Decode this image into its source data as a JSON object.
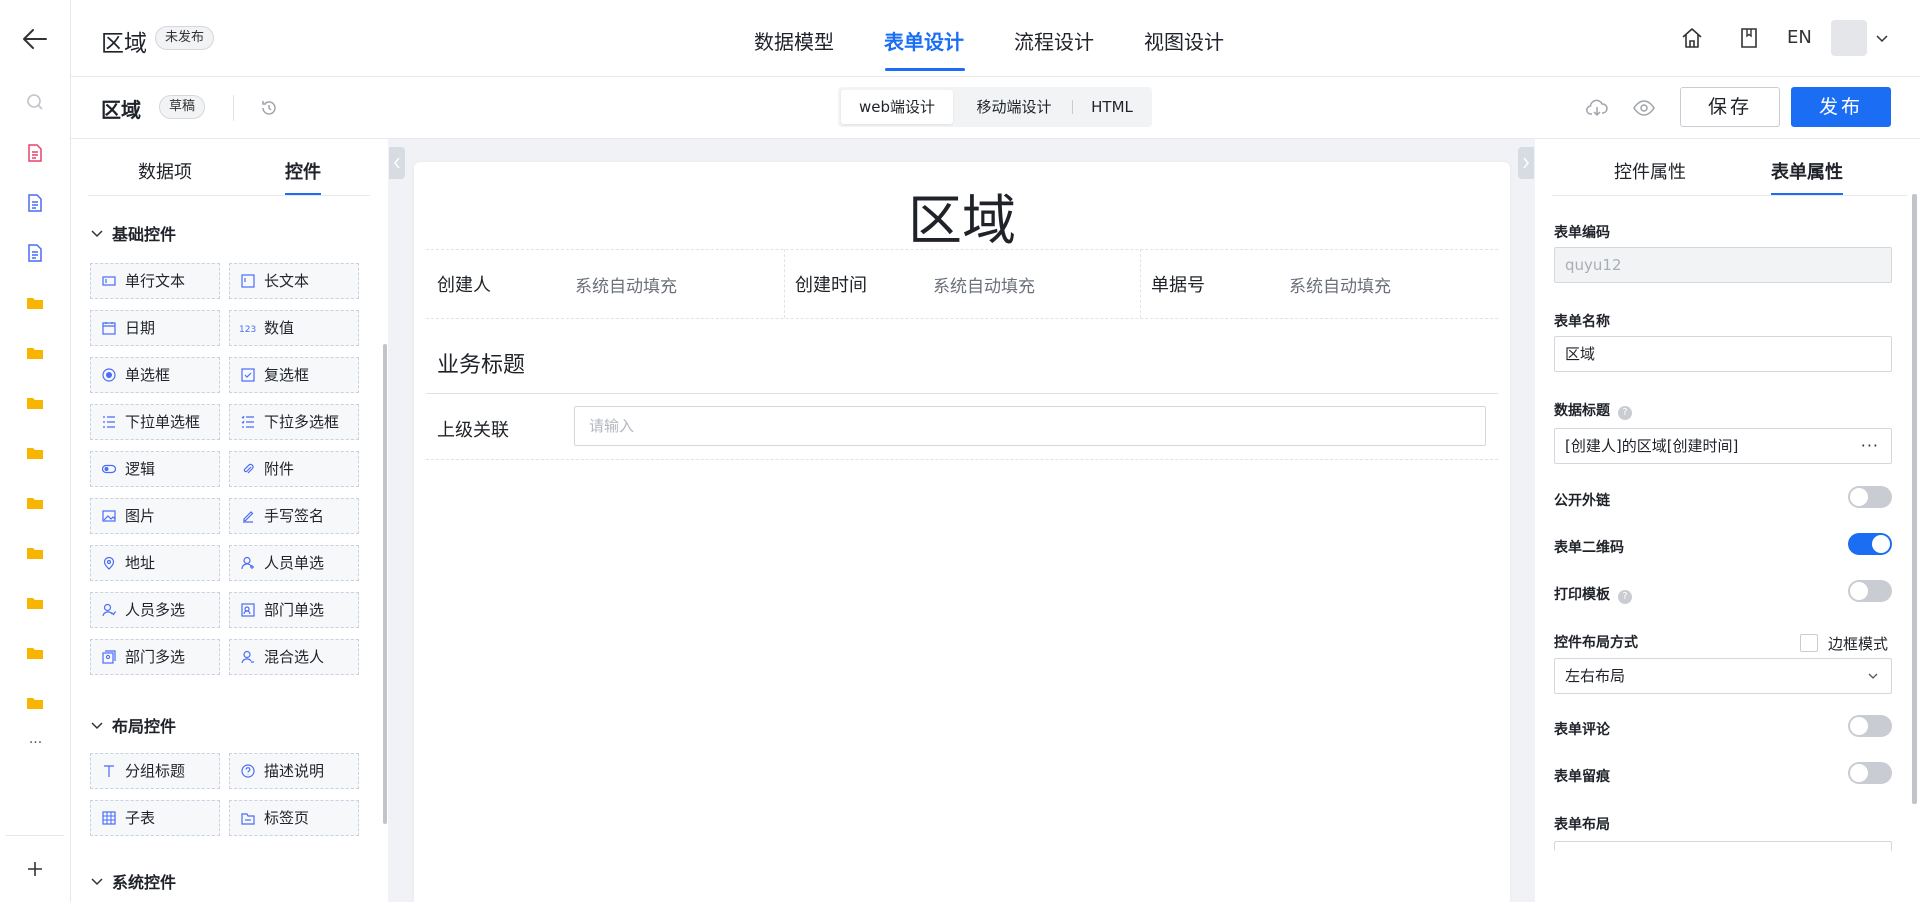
{
  "app": {
    "title": "区域",
    "status_badge": "未发布"
  },
  "nav": {
    "tabs": [
      {
        "label": "数据模型"
      },
      {
        "label": "表单设计"
      },
      {
        "label": "流程设计"
      },
      {
        "label": "视图设计"
      }
    ],
    "active": "表单设计"
  },
  "header": {
    "lang": "EN"
  },
  "form_header": {
    "title": "区域",
    "draft_badge": "草稿"
  },
  "design_modes": {
    "options": [
      "web端设计",
      "移动端设计",
      "HTML"
    ],
    "active": "web端设计"
  },
  "actions": {
    "save": "保存",
    "publish": "发布"
  },
  "left_panel": {
    "tabs": [
      "数据项",
      "控件"
    ],
    "active_tab": "控件",
    "sections": [
      {
        "title": "基础控件",
        "items": [
          {
            "label": "单行文本",
            "icon": "single-line-text-icon"
          },
          {
            "label": "长文本",
            "icon": "long-text-icon"
          },
          {
            "label": "日期",
            "icon": "calendar-icon"
          },
          {
            "label": "数值",
            "icon": "number-icon"
          },
          {
            "label": "单选框",
            "icon": "radio-icon"
          },
          {
            "label": "复选框",
            "icon": "checkbox-icon"
          },
          {
            "label": "下拉单选框",
            "icon": "dropdown-single-icon"
          },
          {
            "label": "下拉多选框",
            "icon": "dropdown-multi-icon"
          },
          {
            "label": "逻辑",
            "icon": "toggle-icon"
          },
          {
            "label": "附件",
            "icon": "paperclip-icon"
          },
          {
            "label": "图片",
            "icon": "image-icon"
          },
          {
            "label": "手写签名",
            "icon": "pen-icon"
          },
          {
            "label": "地址",
            "icon": "location-pin-icon"
          },
          {
            "label": "人员单选",
            "icon": "user-icon"
          },
          {
            "label": "人员多选",
            "icon": "users-icon"
          },
          {
            "label": "部门单选",
            "icon": "department-icon"
          },
          {
            "label": "部门多选",
            "icon": "departments-icon"
          },
          {
            "label": "混合选人",
            "icon": "mixed-user-icon"
          }
        ]
      },
      {
        "title": "布局控件",
        "items": [
          {
            "label": "分组标题",
            "icon": "text-t-icon"
          },
          {
            "label": "描述说明",
            "icon": "help-circle-icon"
          },
          {
            "label": "子表",
            "icon": "table-icon"
          },
          {
            "label": "标签页",
            "icon": "tabs-icon"
          }
        ]
      },
      {
        "title": "系统控件",
        "items": []
      }
    ]
  },
  "canvas": {
    "title": "区域",
    "system_fields": [
      {
        "label": "创建人",
        "value": "系统自动填充"
      },
      {
        "label": "创建时间",
        "value": "系统自动填充"
      },
      {
        "label": "单据号",
        "value": "系统自动填充"
      }
    ],
    "group_title": "业务标题",
    "fields": [
      {
        "label": "上级关联",
        "placeholder": "请输入"
      }
    ]
  },
  "right_panel": {
    "tabs": [
      "控件属性",
      "表单属性"
    ],
    "active_tab": "表单属性",
    "form_code": {
      "label": "表单编码",
      "value": "quyu12"
    },
    "form_name": {
      "label": "表单名称",
      "value": "区域"
    },
    "data_title": {
      "label": "数据标题",
      "value": "[创建人]的区域[创建时间]",
      "more": "···"
    },
    "public_link": {
      "label": "公开外链",
      "on": false
    },
    "qr_code": {
      "label": "表单二维码",
      "on": true
    },
    "print_template": {
      "label": "打印模板",
      "on": false
    },
    "layout_mode": {
      "label": "控件布局方式",
      "checkbox_label": "边框模式",
      "checked": false,
      "value": "左右布局"
    },
    "comments": {
      "label": "表单评论",
      "on": false
    },
    "trace": {
      "label": "表单留痕",
      "on": false
    },
    "form_layout": {
      "label": "表单布局"
    }
  },
  "colors": {
    "accent": "#1b6ef3",
    "doc_red": "#e8436c",
    "doc_blue": "#4a6cf7",
    "folder_yellow": "#f7b500"
  }
}
